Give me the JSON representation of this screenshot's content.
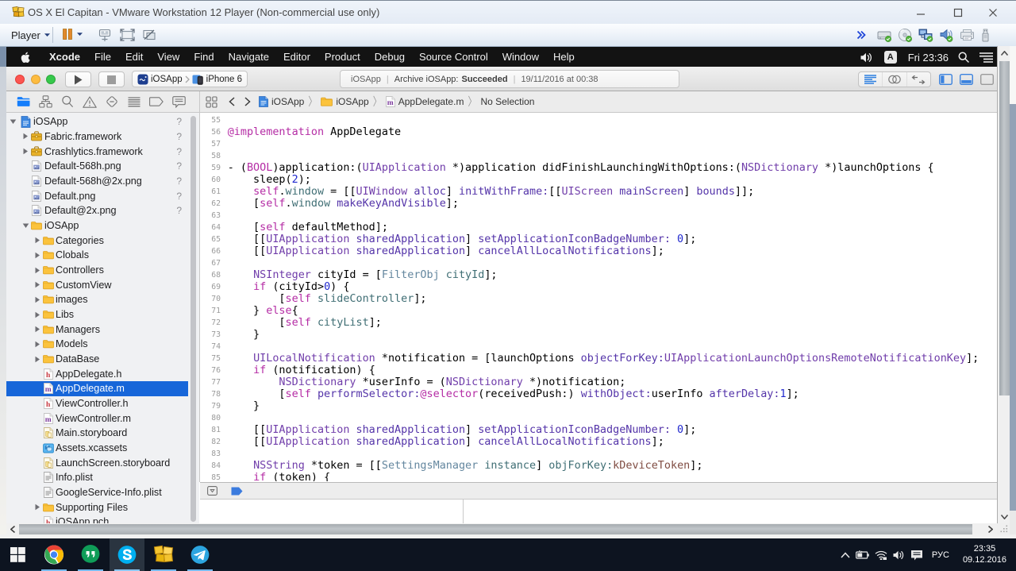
{
  "vmware": {
    "title": "OS X El Capitan - VMware Workstation 12 Player (Non-commercial use only)",
    "player_menu": "Player",
    "window_buttons": {
      "minimize": "minimize",
      "maximize": "maximize",
      "close": "close"
    },
    "toolbar_buttons": [
      "pause",
      "ctrl-alt-del",
      "fullscreen",
      "unity"
    ],
    "device_icons": [
      "hard-disk",
      "cd-dvd",
      "network",
      "sound",
      "printer",
      "usb"
    ]
  },
  "macos": {
    "menu_items": [
      "Xcode",
      "File",
      "Edit",
      "View",
      "Find",
      "Navigate",
      "Editor",
      "Product",
      "Debug",
      "Source Control",
      "Window",
      "Help"
    ],
    "input_source": "A",
    "clock": "Fri 23:36"
  },
  "xcode": {
    "toolbar": {
      "scheme": "iOSApp",
      "device": "iPhone 6",
      "status_project": "iOSApp",
      "status_action": "Archive iOSApp:",
      "status_result": "Succeeded",
      "status_date": "19/11/2016 at 00:38",
      "status_separator": "|"
    },
    "navigator_tabs": [
      "project",
      "symbols",
      "search",
      "issues",
      "tests",
      "debug",
      "breakpoints",
      "reports"
    ],
    "jump_bar": {
      "separator": "〉",
      "crumbs": [
        {
          "icon": "project-doc",
          "label": "iOSApp"
        },
        {
          "icon": "folder",
          "label": "iOSApp"
        },
        {
          "icon": "m-file",
          "label": "AppDelegate.m"
        },
        {
          "icon": "",
          "label": "No Selection"
        }
      ]
    },
    "file_tree": [
      {
        "level": 0,
        "disc": "open",
        "icon": "project",
        "label": "iOSApp",
        "badge": "?"
      },
      {
        "level": 1,
        "disc": "closed",
        "icon": "framework",
        "label": "Fabric.framework",
        "badge": "?"
      },
      {
        "level": 1,
        "disc": "closed",
        "icon": "framework",
        "label": "Crashlytics.framework",
        "badge": "?"
      },
      {
        "level": 1,
        "disc": "",
        "icon": "image",
        "label": "Default-568h.png",
        "badge": "?"
      },
      {
        "level": 1,
        "disc": "",
        "icon": "image",
        "label": "Default-568h@2x.png",
        "badge": "?"
      },
      {
        "level": 1,
        "disc": "",
        "icon": "image",
        "label": "Default.png",
        "badge": "?"
      },
      {
        "level": 1,
        "disc": "",
        "icon": "image",
        "label": "Default@2x.png",
        "badge": "?"
      },
      {
        "level": 1,
        "disc": "open",
        "icon": "folder",
        "label": "iOSApp",
        "badge": ""
      },
      {
        "level": 2,
        "disc": "closed",
        "icon": "folder",
        "label": "Categories",
        "badge": ""
      },
      {
        "level": 2,
        "disc": "closed",
        "icon": "folder",
        "label": "Clobals",
        "badge": ""
      },
      {
        "level": 2,
        "disc": "closed",
        "icon": "folder",
        "label": "Controllers",
        "badge": ""
      },
      {
        "level": 2,
        "disc": "closed",
        "icon": "folder",
        "label": "CustomView",
        "badge": ""
      },
      {
        "level": 2,
        "disc": "closed",
        "icon": "folder",
        "label": "images",
        "badge": ""
      },
      {
        "level": 2,
        "disc": "closed",
        "icon": "folder",
        "label": "Libs",
        "badge": ""
      },
      {
        "level": 2,
        "disc": "closed",
        "icon": "folder",
        "label": "Managers",
        "badge": ""
      },
      {
        "level": 2,
        "disc": "closed",
        "icon": "folder",
        "label": "Models",
        "badge": ""
      },
      {
        "level": 2,
        "disc": "closed",
        "icon": "folder",
        "label": "DataBase",
        "badge": ""
      },
      {
        "level": 2,
        "disc": "",
        "icon": "h-file",
        "label": "AppDelegate.h",
        "badge": ""
      },
      {
        "level": 2,
        "disc": "",
        "icon": "m-file",
        "label": "AppDelegate.m",
        "badge": "",
        "selected": true
      },
      {
        "level": 2,
        "disc": "",
        "icon": "h-file",
        "label": "ViewController.h",
        "badge": ""
      },
      {
        "level": 2,
        "disc": "",
        "icon": "m-file",
        "label": "ViewController.m",
        "badge": ""
      },
      {
        "level": 2,
        "disc": "",
        "icon": "storyboard",
        "label": "Main.storyboard",
        "badge": ""
      },
      {
        "level": 2,
        "disc": "",
        "icon": "xcassets",
        "label": "Assets.xcassets",
        "badge": ""
      },
      {
        "level": 2,
        "disc": "",
        "icon": "storyboard",
        "label": "LaunchScreen.storyboard",
        "badge": ""
      },
      {
        "level": 2,
        "disc": "",
        "icon": "plist",
        "label": "Info.plist",
        "badge": ""
      },
      {
        "level": 2,
        "disc": "",
        "icon": "plist",
        "label": "GoogleService-Info.plist",
        "badge": ""
      },
      {
        "level": 2,
        "disc": "closed",
        "icon": "folder",
        "label": "Supporting Files",
        "badge": ""
      },
      {
        "level": 2,
        "disc": "",
        "icon": "h-file",
        "label": "iOSApp.pch",
        "badge": ""
      }
    ],
    "editor": {
      "breadcrumb_file": "AppDelegate.m",
      "first_line_number": 55,
      "lines": [
        [],
        [
          [
            "k",
            "@implementation"
          ],
          [
            "t",
            " AppDelegate"
          ]
        ],
        [],
        [],
        [
          [
            "t",
            "- ("
          ],
          [
            "k",
            "BOOL"
          ],
          [
            "t",
            ")application:("
          ],
          [
            "c",
            "UIApplication"
          ],
          [
            "t",
            " *)application didFinishLaunchingWithOptions:("
          ],
          [
            "c",
            "NSDictionary"
          ],
          [
            "t",
            " *)launchOptions {"
          ]
        ],
        [
          [
            "t",
            "    sleep("
          ],
          [
            "n",
            "2"
          ],
          [
            "t",
            ");"
          ]
        ],
        [
          [
            "t",
            "    "
          ],
          [
            "k",
            "self"
          ],
          [
            "t",
            "."
          ],
          [
            "pm",
            "window"
          ],
          [
            "t",
            " = [["
          ],
          [
            "c",
            "UIWindow"
          ],
          [
            "t",
            " "
          ],
          [
            "f",
            "alloc"
          ],
          [
            "t",
            "] "
          ],
          [
            "f",
            "initWithFrame:"
          ],
          [
            "t",
            "[["
          ],
          [
            "c",
            "UIScreen"
          ],
          [
            "t",
            " "
          ],
          [
            "f",
            "mainScreen"
          ],
          [
            "t",
            "] "
          ],
          [
            "f",
            "bounds"
          ],
          [
            "t",
            "]];"
          ]
        ],
        [
          [
            "t",
            "    ["
          ],
          [
            "k",
            "self"
          ],
          [
            "t",
            "."
          ],
          [
            "pm",
            "window"
          ],
          [
            "t",
            " "
          ],
          [
            "f",
            "makeKeyAndVisible"
          ],
          [
            "t",
            "];"
          ]
        ],
        [],
        [
          [
            "t",
            "    ["
          ],
          [
            "k",
            "self"
          ],
          [
            "t",
            " defaultMethod];"
          ]
        ],
        [
          [
            "t",
            "    [["
          ],
          [
            "c",
            "UIApplication"
          ],
          [
            "t",
            " "
          ],
          [
            "f",
            "sharedApplication"
          ],
          [
            "t",
            "] "
          ],
          [
            "f",
            "setApplicationIconBadgeNumber:"
          ],
          [
            "t",
            " "
          ],
          [
            "n",
            "0"
          ],
          [
            "t",
            "];"
          ]
        ],
        [
          [
            "t",
            "    [["
          ],
          [
            "c",
            "UIApplication"
          ],
          [
            "t",
            " "
          ],
          [
            "f",
            "sharedApplication"
          ],
          [
            "t",
            "] "
          ],
          [
            "f",
            "cancelAllLocalNotifications"
          ],
          [
            "t",
            "];"
          ]
        ],
        [],
        [
          [
            "t",
            "    "
          ],
          [
            "c",
            "NSInteger"
          ],
          [
            "t",
            " cityId = ["
          ],
          [
            "pc",
            "FilterObj"
          ],
          [
            "t",
            " "
          ],
          [
            "pm",
            "cityId"
          ],
          [
            "t",
            "];"
          ]
        ],
        [
          [
            "t",
            "    "
          ],
          [
            "k",
            "if"
          ],
          [
            "t",
            " (cityId>"
          ],
          [
            "n",
            "0"
          ],
          [
            "t",
            ") {"
          ]
        ],
        [
          [
            "t",
            "        ["
          ],
          [
            "k",
            "self"
          ],
          [
            "t",
            " "
          ],
          [
            "pm",
            "slideController"
          ],
          [
            "t",
            "];"
          ]
        ],
        [
          [
            "t",
            "    } "
          ],
          [
            "k",
            "else"
          ],
          [
            "t",
            "{"
          ]
        ],
        [
          [
            "t",
            "        ["
          ],
          [
            "k",
            "self"
          ],
          [
            "t",
            " "
          ],
          [
            "pm",
            "cityList"
          ],
          [
            "t",
            "];"
          ]
        ],
        [
          [
            "t",
            "    }"
          ]
        ],
        [],
        [
          [
            "t",
            "    "
          ],
          [
            "c",
            "UILocalNotification"
          ],
          [
            "t",
            " *notification = [launchOptions "
          ],
          [
            "f",
            "objectForKey:"
          ],
          [
            "c",
            "UIApplicationLaunchOptionsRemoteNotificationKey"
          ],
          [
            "t",
            "];"
          ]
        ],
        [
          [
            "t",
            "    "
          ],
          [
            "k",
            "if"
          ],
          [
            "t",
            " (notification) {"
          ]
        ],
        [
          [
            "t",
            "        "
          ],
          [
            "c",
            "NSDictionary"
          ],
          [
            "t",
            " *userInfo = ("
          ],
          [
            "c",
            "NSDictionary"
          ],
          [
            "t",
            " *)notification;"
          ]
        ],
        [
          [
            "t",
            "        ["
          ],
          [
            "k",
            "self"
          ],
          [
            "t",
            " "
          ],
          [
            "f",
            "performSelector:"
          ],
          [
            "k",
            "@selector"
          ],
          [
            "t",
            "(receivedPush:) "
          ],
          [
            "f",
            "withObject:"
          ],
          [
            "t",
            "userInfo "
          ],
          [
            "f",
            "afterDelay:"
          ],
          [
            "n",
            "1"
          ],
          [
            "t",
            "];"
          ]
        ],
        [
          [
            "t",
            "    }"
          ]
        ],
        [],
        [
          [
            "t",
            "    [["
          ],
          [
            "c",
            "UIApplication"
          ],
          [
            "t",
            " "
          ],
          [
            "f",
            "sharedApplication"
          ],
          [
            "t",
            "] "
          ],
          [
            "f",
            "setApplicationIconBadgeNumber:"
          ],
          [
            "t",
            " "
          ],
          [
            "n",
            "0"
          ],
          [
            "t",
            "];"
          ]
        ],
        [
          [
            "t",
            "    [["
          ],
          [
            "c",
            "UIApplication"
          ],
          [
            "t",
            " "
          ],
          [
            "f",
            "sharedApplication"
          ],
          [
            "t",
            "] "
          ],
          [
            "f",
            "cancelAllLocalNotifications"
          ],
          [
            "t",
            "];"
          ]
        ],
        [],
        [
          [
            "t",
            "    "
          ],
          [
            "c",
            "NSString"
          ],
          [
            "t",
            " *token = [["
          ],
          [
            "pc",
            "SettingsManager"
          ],
          [
            "t",
            " "
          ],
          [
            "pm",
            "instance"
          ],
          [
            "t",
            "] "
          ],
          [
            "pm",
            "objForKey:"
          ],
          [
            "m",
            "kDeviceToken"
          ],
          [
            "t",
            "];"
          ]
        ],
        [
          [
            "t",
            "    "
          ],
          [
            "k",
            "if"
          ],
          [
            "t",
            " (token) {"
          ]
        ]
      ]
    }
  },
  "taskbar": {
    "apps": [
      "start",
      "chrome",
      "hangouts",
      "skype",
      "vmware",
      "telegram"
    ],
    "active_app": "skype",
    "tray_icons": [
      "tray-chevron",
      "battery",
      "wifi",
      "volume",
      "action-center"
    ],
    "language": "РУС",
    "time": "23:35",
    "date": "09.12.2016"
  },
  "colors": {
    "selection_blue": "#1766D9",
    "keyword_pink": "#B52DA5",
    "class_purple": "#703DAA",
    "number_blue": "#2028CE",
    "taskbar_bg": "#0D1420",
    "menubar_bg": "#131313"
  }
}
